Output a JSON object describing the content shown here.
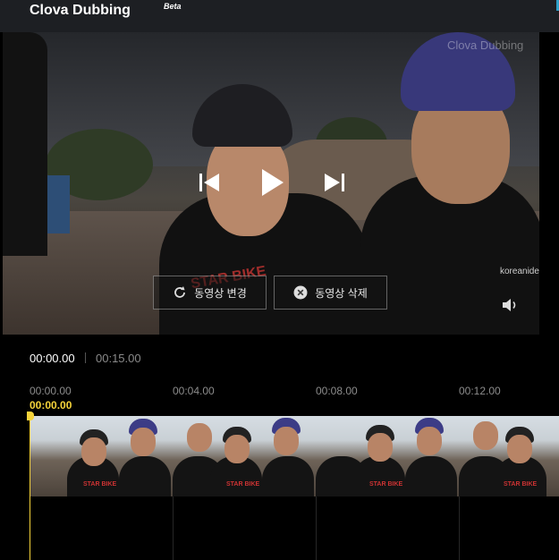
{
  "app": {
    "title": "Clova Dubbing",
    "badge": "Beta"
  },
  "player": {
    "watermark": "Clova Dubbing",
    "shirt_print": "STAR BIKE",
    "brand_text": "koreanide",
    "buttons": {
      "change": "동영상 변경",
      "delete": "동영상 삭제"
    },
    "controls": [
      "previous",
      "play",
      "next",
      "volume"
    ]
  },
  "timeline": {
    "current_time": "00:00.00",
    "total_time": "00:15.00",
    "ticks": [
      "00:00.00",
      "00:04.00",
      "00:08.00",
      "00:12.00"
    ],
    "playhead_time": "00:00.00",
    "playhead_color": "#f5d33a"
  },
  "colors": {
    "header_bg": "#1d1f23",
    "background": "#000000",
    "accent": "#2ea0c9"
  }
}
